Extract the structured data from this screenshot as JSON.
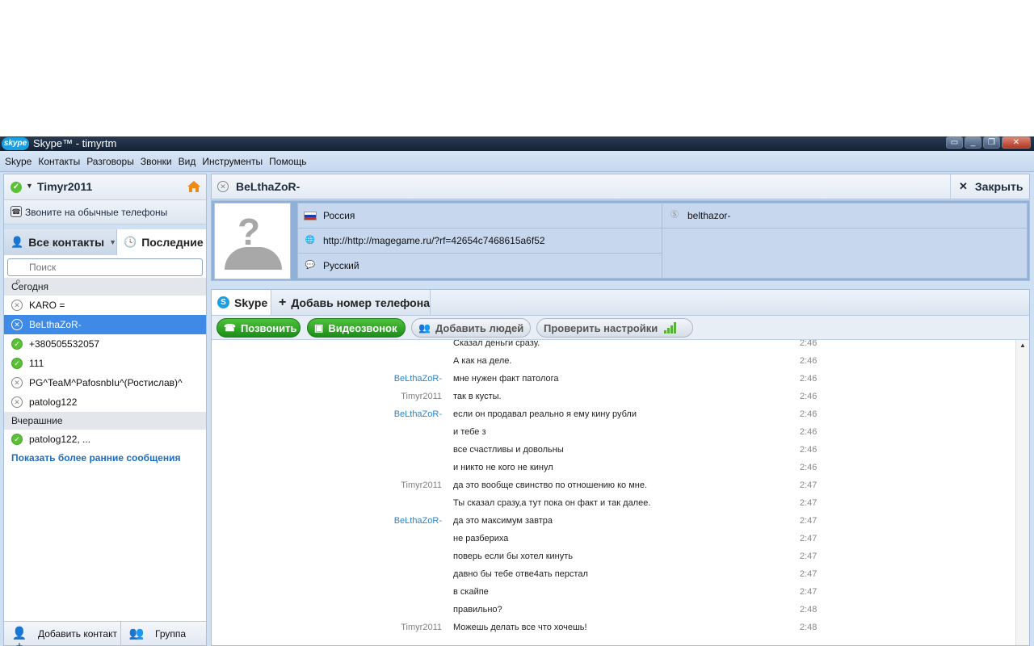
{
  "titlebar": {
    "title": "Skype™ - timyrtm",
    "logo": "skype"
  },
  "menu": [
    "Skype",
    "Контакты",
    "Разговоры",
    "Звонки",
    "Вид",
    "Инструменты",
    "Помощь"
  ],
  "user": {
    "name": "Timyr2011"
  },
  "call_phones": "Звоните на обычные телефоны",
  "tabs": {
    "contacts": "Все контакты",
    "recent": "Последние"
  },
  "search": {
    "placeholder": "Поиск"
  },
  "sections": {
    "today": "Сегодня",
    "yesterday": "Вчерашние"
  },
  "contacts_today": [
    {
      "name": "KARO =",
      "online": false,
      "selected": false
    },
    {
      "name": "BeLthaZoR-",
      "online": false,
      "selected": true
    },
    {
      "name": "+380505532057",
      "online": true,
      "selected": false
    },
    {
      "name": "111",
      "online": true,
      "selected": false
    },
    {
      "name": "PG^TeaM^PafosnbIu^(Ростислав)^",
      "online": false,
      "selected": false
    },
    {
      "name": "patolog122",
      "online": false,
      "selected": false
    }
  ],
  "contacts_yesterday": [
    {
      "name": "patolog122, ...",
      "online": true
    }
  ],
  "show_earlier": "Показать более ранние сообщения",
  "bottom": {
    "add_contact": "Добавить контакт",
    "group": "Группа"
  },
  "contact": {
    "name": "BeLthaZoR-",
    "close": "Закрыть"
  },
  "profile": {
    "country": "Россия",
    "url": "http://http://magegame.ru/?rf=42654c7468615a6f52",
    "language": "Русский",
    "skype_name": "belthazor-"
  },
  "chat_tabs": {
    "skype": "Skype",
    "add_phone": "Добавь номер телефона"
  },
  "actions": {
    "call": "Позвонить",
    "video": "Видеозвонок",
    "add_people": "Добавить людей",
    "check_settings": "Проверить настройки"
  },
  "messages": [
    {
      "author": "",
      "me": false,
      "text": "Сказал деньги сразу.",
      "time": "2:46"
    },
    {
      "author": "",
      "me": false,
      "text": "А как на деле.",
      "time": "2:46"
    },
    {
      "author": "BeLthaZoR-",
      "me": false,
      "text": "мне нужен факт патолога",
      "time": "2:46"
    },
    {
      "author": "Timyr2011",
      "me": true,
      "text": "так в кусты.",
      "time": "2:46"
    },
    {
      "author": "BeLthaZoR-",
      "me": false,
      "text": "если он продавал реально я ему кину рубли",
      "time": "2:46"
    },
    {
      "author": "",
      "me": false,
      "text": "и тебе з",
      "time": "2:46"
    },
    {
      "author": "",
      "me": false,
      "text": "все счастливы и довольны",
      "time": "2:46"
    },
    {
      "author": "",
      "me": false,
      "text": "и никто не кого не кинул",
      "time": "2:46"
    },
    {
      "author": "Timyr2011",
      "me": true,
      "text": "да это вообще свинство по отношению ко мне.",
      "time": "2:47"
    },
    {
      "author": "",
      "me": true,
      "text": "Ты сказал сразу,а тут пока он факт и так далее.",
      "time": "2:47"
    },
    {
      "author": "BeLthaZoR-",
      "me": false,
      "text": "да это максимум завтра",
      "time": "2:47"
    },
    {
      "author": "",
      "me": false,
      "text": "не разбериха",
      "time": "2:47"
    },
    {
      "author": "",
      "me": false,
      "text": "поверь если бы хотел кинуть",
      "time": "2:47"
    },
    {
      "author": "",
      "me": false,
      "text": "давно бы тебе отве4ать перстал",
      "time": "2:47"
    },
    {
      "author": "",
      "me": false,
      "text": "в скайпе",
      "time": "2:47"
    },
    {
      "author": "",
      "me": false,
      "text": "правильно?",
      "time": "2:48"
    },
    {
      "author": "Timyr2011",
      "me": true,
      "text": "Можешь делать все что хочешь!",
      "time": "2:48"
    }
  ]
}
